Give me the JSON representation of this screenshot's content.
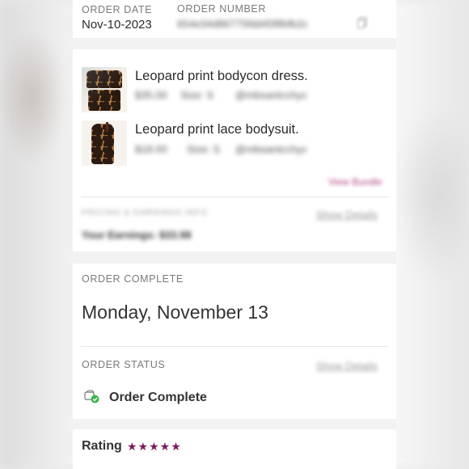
{
  "order": {
    "date_label": "ORDER DATE",
    "date_value": "Nov-10-2023",
    "number_label": "ORDER NUMBER",
    "number_value": "654e34d86775fdd45f8bfb2c"
  },
  "items": [
    {
      "title": "Leopard print bodycon dress.",
      "price": "$35.00",
      "size": "Size: S",
      "seller": "@mbsantcchyc"
    },
    {
      "title": "Leopard print lace bodysuit.",
      "price": "$18.00",
      "size": "Size: S",
      "seller": "@mbsantcchyc"
    }
  ],
  "bundle_link": "View Bundle",
  "pricing": {
    "label": "PRICING & EARNINGS INFO",
    "details_link": "Show Details",
    "earnings": "Your Earnings: $33.98"
  },
  "order_complete": {
    "label": "ORDER COMPLETE",
    "date": "Monday, November 13"
  },
  "order_status": {
    "label": "ORDER STATUS",
    "details_link": "Show Details",
    "status": "Order Complete"
  },
  "rating": {
    "label": "Rating",
    "stars": "★★★★★"
  },
  "colors": {
    "accent": "#7b1a5c",
    "success": "#3bb54a",
    "link_pink": "#b0468a"
  }
}
